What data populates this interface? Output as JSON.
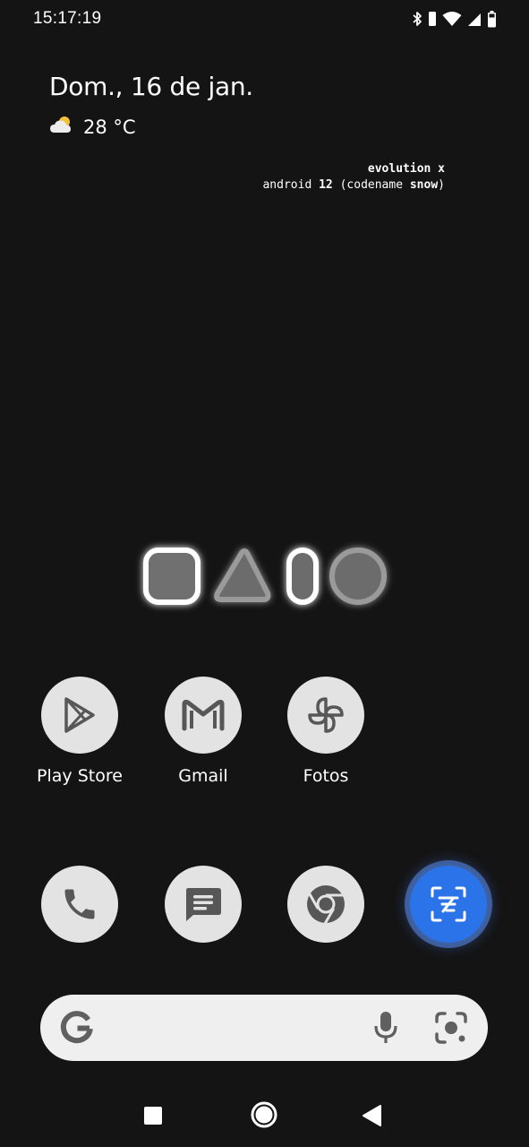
{
  "status_bar": {
    "time": "15:17:19",
    "icons": [
      "bluetooth-icon",
      "vibrate-icon",
      "wifi-icon",
      "cell-signal-icon",
      "battery-icon"
    ]
  },
  "glance": {
    "date": "Dom., 16 de jan.",
    "temperature": "28 °C",
    "weather_icon": "partly-cloudy-icon"
  },
  "rom_info": {
    "name": "evolution x",
    "version_prefix": "android ",
    "version_number": "12",
    "version_mid": " (codename ",
    "codename": "snow",
    "version_suffix": ")"
  },
  "apps": [
    {
      "label": "Play Store",
      "icon": "play-store-icon"
    },
    {
      "label": "Gmail",
      "icon": "gmail-icon"
    },
    {
      "label": "Fotos",
      "icon": "photos-pinwheel-icon"
    }
  ],
  "dock": [
    {
      "icon": "phone-icon"
    },
    {
      "icon": "messages-icon"
    },
    {
      "icon": "chrome-icon"
    },
    {
      "icon": "scanner-icon"
    }
  ],
  "search": {
    "google_icon": "google-g-icon",
    "mic_icon": "microphone-icon",
    "lens_icon": "lens-icon"
  },
  "navigation": {
    "recents": "recents-square-icon",
    "home": "home-circle-icon",
    "back": "back-triangle-icon"
  },
  "colors": {
    "background": "#141414",
    "icon_background": "#e3e3e3",
    "icon_glyph": "#575757",
    "scanner_accent": "#2a73e8",
    "search_bar": "#efefef"
  }
}
